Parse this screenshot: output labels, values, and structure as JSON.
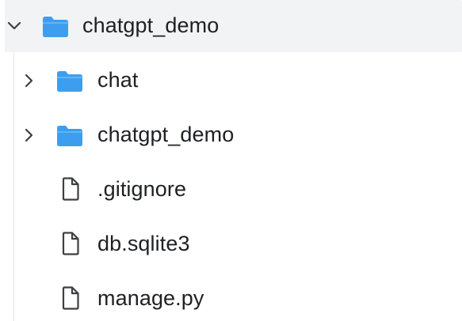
{
  "tree": {
    "root": {
      "label": "chatgpt_demo",
      "expanded": true,
      "icon": "folder-icon",
      "chevron": "chevron-down-icon"
    },
    "children": [
      {
        "label": "chat",
        "type": "folder",
        "expanded": false,
        "icon": "folder-icon",
        "chevron": "chevron-right-icon"
      },
      {
        "label": "chatgpt_demo",
        "type": "folder",
        "expanded": false,
        "icon": "folder-icon",
        "chevron": "chevron-right-icon"
      },
      {
        "label": ".gitignore",
        "type": "file",
        "icon": "file-icon"
      },
      {
        "label": "db.sqlite3",
        "type": "file",
        "icon": "file-icon"
      },
      {
        "label": "manage.py",
        "type": "file",
        "icon": "file-icon"
      }
    ]
  },
  "colors": {
    "folder": "#3d9ef0",
    "selected_row": "#f1f3f4",
    "text": "#202124",
    "icon_stroke": "#3c4043"
  }
}
